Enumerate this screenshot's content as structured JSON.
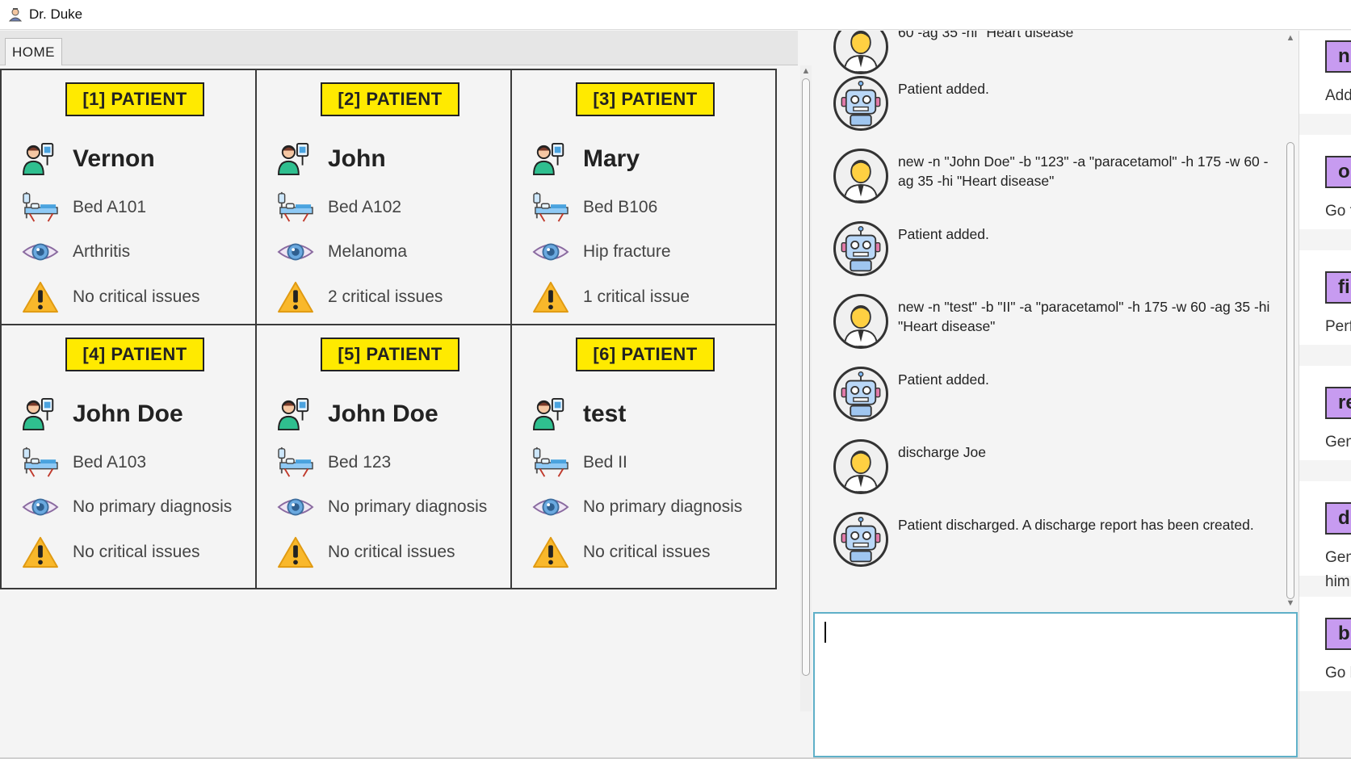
{
  "window": {
    "title": "Dr. Duke"
  },
  "tabs": [
    {
      "label": "HOME"
    }
  ],
  "patients": [
    {
      "badge": "[1] PATIENT",
      "name": "Vernon",
      "bed": "Bed A101",
      "diagnosis": "Arthritis",
      "critical": "No critical issues"
    },
    {
      "badge": "[2] PATIENT",
      "name": "John",
      "bed": "Bed A102",
      "diagnosis": "Melanoma",
      "critical": "2 critical issues"
    },
    {
      "badge": "[3] PATIENT",
      "name": "Mary",
      "bed": "Bed B106",
      "diagnosis": "Hip fracture",
      "critical": "1 critical issue"
    },
    {
      "badge": "[4] PATIENT",
      "name": "John Doe",
      "bed": "Bed A103",
      "diagnosis": "No primary diagnosis",
      "critical": "No critical issues"
    },
    {
      "badge": "[5] PATIENT",
      "name": "John Doe",
      "bed": "Bed 123",
      "diagnosis": "No primary diagnosis",
      "critical": "No critical issues"
    },
    {
      "badge": "[6] PATIENT",
      "name": "test",
      "bed": "Bed II",
      "diagnosis": "No primary diagnosis",
      "critical": "No critical issues"
    }
  ],
  "chat": [
    {
      "sender": "user",
      "text": "60 -ag 35 -hi \"Heart disease\""
    },
    {
      "sender": "bot",
      "text": "Patient added."
    },
    {
      "sender": "user",
      "text": "new -n \"John Doe\" -b \"123\" -a \"paracetamol\" -h 175 -w 60 -ag 35 -hi \"Heart disease\""
    },
    {
      "sender": "bot",
      "text": "Patient added."
    },
    {
      "sender": "user",
      "text": "new -n \"test\" -b \"II\" -a \"paracetamol\" -h 175 -w 60 -ag 35 -hi \"Heart disease\""
    },
    {
      "sender": "bot",
      "text": "Patient added."
    },
    {
      "sender": "user",
      "text": "discharge Joe"
    },
    {
      "sender": "bot",
      "text": "Patient discharged. A discharge report has been created."
    }
  ],
  "input": {
    "value": ""
  },
  "help": [
    {
      "cmd": "n",
      "desc": "Add"
    },
    {
      "cmd": "o",
      "desc": "Go t"
    },
    {
      "cmd": "fi",
      "desc": "Perf"
    },
    {
      "cmd": "re",
      "desc": "Gen"
    },
    {
      "cmd": "d",
      "desc": "Gen",
      "desc2": "him"
    },
    {
      "cmd": "b",
      "desc": "Go b"
    }
  ],
  "colors": {
    "badge": "#ffea00",
    "help_cmd": "#c79bf0",
    "input_border": "#5fb0c8"
  }
}
